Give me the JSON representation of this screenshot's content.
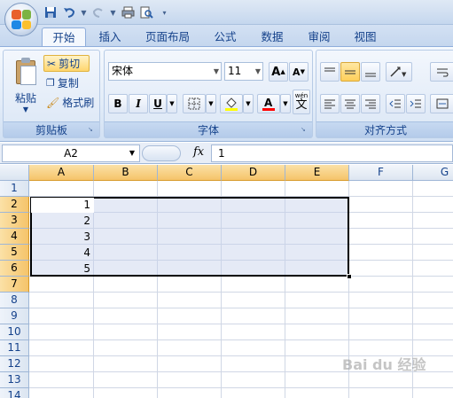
{
  "quick_access": {
    "undo_icon": "undo-icon",
    "redo_icon": "redo-icon",
    "save_icon": "save-icon",
    "print_icon": "print-icon",
    "preview_icon": "print-preview-icon"
  },
  "tabs": [
    {
      "label": "开始",
      "active": true
    },
    {
      "label": "插入"
    },
    {
      "label": "页面布局"
    },
    {
      "label": "公式"
    },
    {
      "label": "数据"
    },
    {
      "label": "审阅"
    },
    {
      "label": "视图"
    }
  ],
  "clipboard": {
    "paste_label": "粘贴",
    "cut_label": "剪切",
    "copy_label": "复制",
    "format_painter_label": "格式刷",
    "group_label": "剪贴板"
  },
  "font": {
    "font_name": "宋体",
    "font_size": "11",
    "bold": "B",
    "italic": "I",
    "underline": "U",
    "wen": "wén",
    "wen_char": "文",
    "group_label": "字体",
    "fill_color": "#ffff00",
    "font_color": "#ff0000"
  },
  "alignment": {
    "group_label": "对齐方式"
  },
  "formula_bar": {
    "name_box": "A2",
    "fx": "fx",
    "value": "1"
  },
  "columns": [
    "A",
    "B",
    "C",
    "D",
    "E",
    "F",
    "G"
  ],
  "rows": [
    "1",
    "2",
    "3",
    "4",
    "5",
    "6",
    "7",
    "8",
    "9",
    "10",
    "11",
    "12",
    "13",
    "14"
  ],
  "cells": {
    "A2": "1",
    "A3": "2",
    "A4": "3",
    "A5": "4",
    "A6": "5"
  },
  "watermark": "Bai du 经验"
}
